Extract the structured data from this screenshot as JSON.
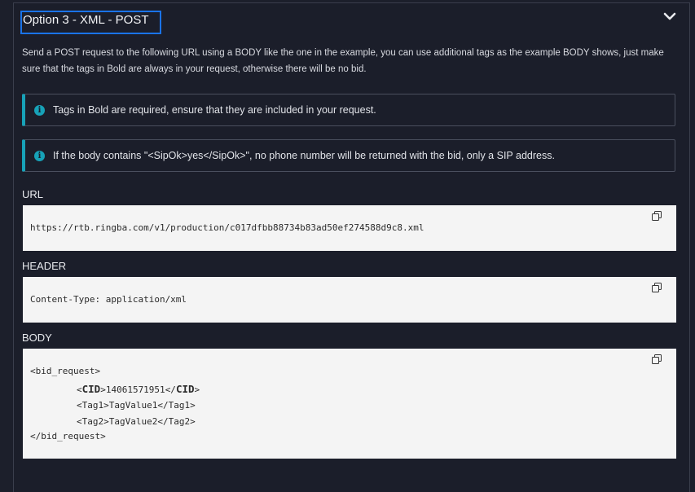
{
  "header": {
    "title": "Option 3 - XML - POST"
  },
  "description": "Send a POST request to the following URL using a BODY like the one in the example, you can use additional tags as the example BODY shows, just make sure that the tags in Bold are always in your request, otherwise there will be no bid.",
  "alerts": [
    {
      "icon": "info-icon",
      "text": "Tags in Bold are required, ensure that they are included in your request."
    },
    {
      "icon": "info-icon",
      "text": "If the body contains \"<SipOk>yes</SipOk>\", no phone number will be returned with the bid, only a SIP address."
    }
  ],
  "url_section": {
    "label": "URL",
    "value": "https://rtb.ringba.com/v1/production/c017dfbb88734b83ad50ef274588d9c8.xml"
  },
  "header_section": {
    "label": "HEADER",
    "value": "Content-Type: application/xml"
  },
  "body_section": {
    "label": "BODY",
    "lines": {
      "open": "<bid_request>",
      "cid_open_pre": "<",
      "cid_tag": "CID",
      "cid_open_post": ">",
      "cid_value": "14061571951",
      "cid_close_pre": "</",
      "cid_close_post": ">",
      "tag1": "<Tag1>TagValue1</Tag1>",
      "tag2": "<Tag2>TagValue2</Tag2>",
      "close": "</bid_request>"
    }
  },
  "colors": {
    "accent": "#1a73e8",
    "info": "#17a2b8",
    "background": "#1c1f2b"
  }
}
